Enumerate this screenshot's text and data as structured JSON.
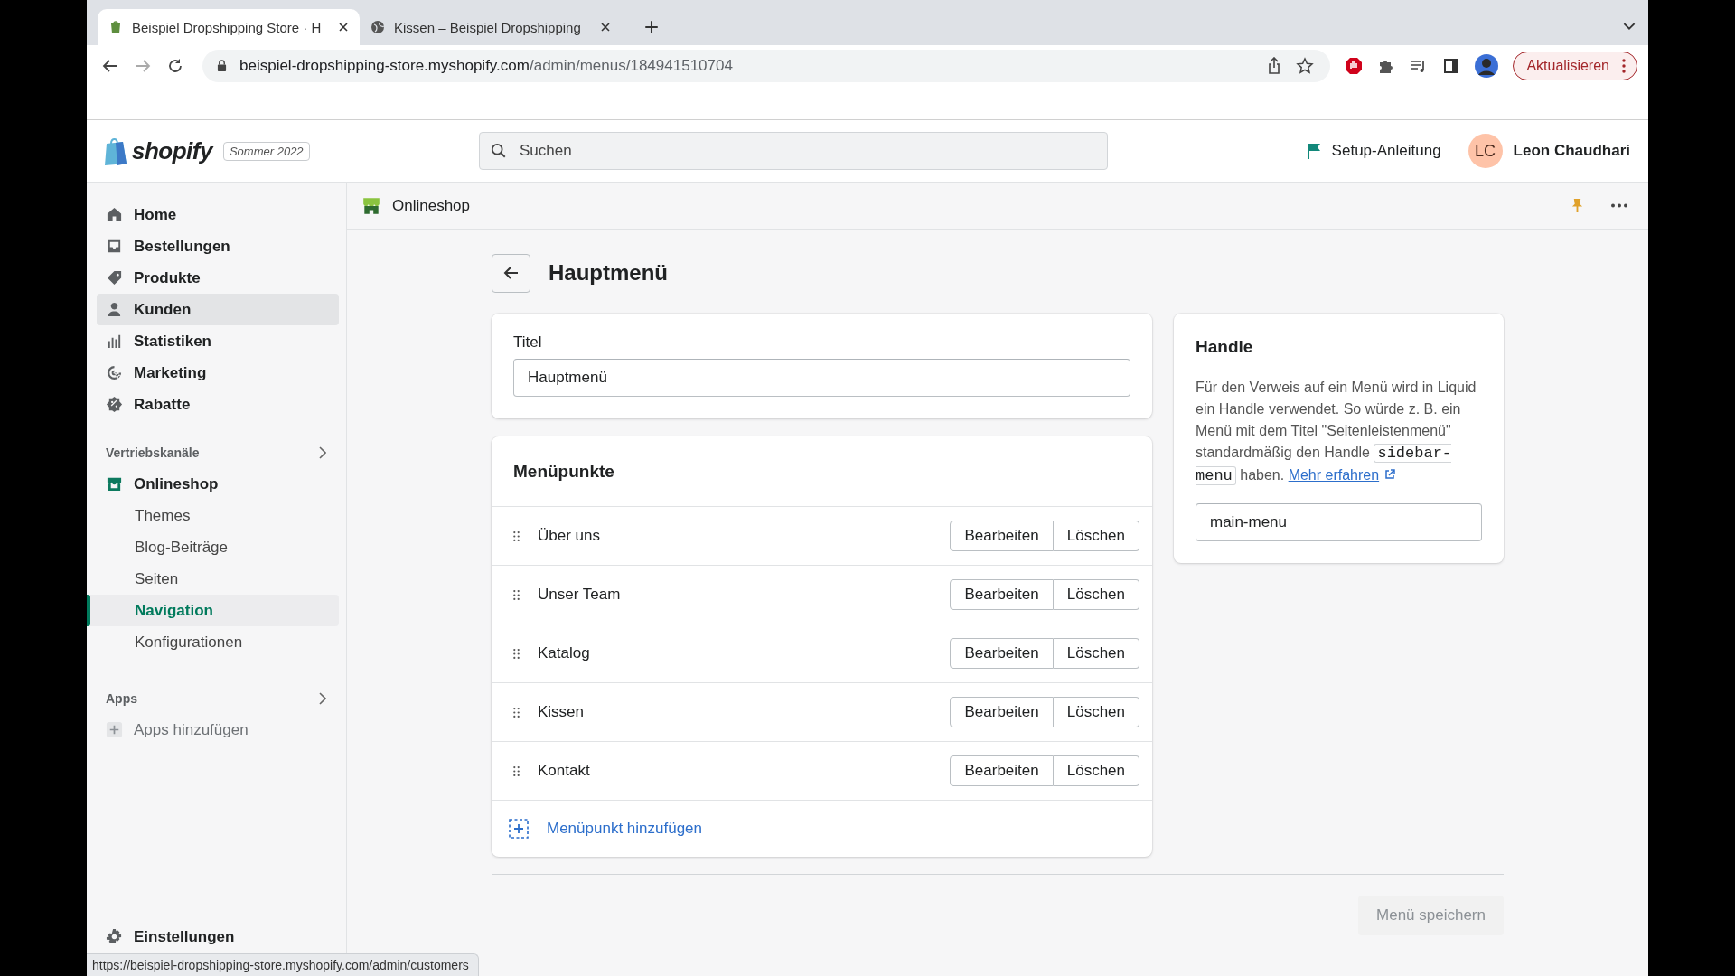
{
  "browser": {
    "tabs": [
      {
        "title": "Beispiel Dropshipping Store · H",
        "selected": true
      },
      {
        "title": "Kissen – Beispiel Dropshipping",
        "selected": false
      }
    ],
    "url": {
      "host": "beispiel-dropshipping-store.myshopify.com",
      "path": "/admin/menus/184941510704"
    },
    "update_button": "Aktualisieren"
  },
  "topbar": {
    "logo": "shopify",
    "edition": "Sommer 2022",
    "search": {
      "placeholder": "Suchen"
    },
    "setup": "Setup-Anleitung",
    "user": {
      "initials": "LC",
      "name": "Leon Chaudhari"
    }
  },
  "sidebar": {
    "items": [
      {
        "label": "Home",
        "hovered": false
      },
      {
        "label": "Bestellungen",
        "hovered": false
      },
      {
        "label": "Produkte",
        "hovered": false
      },
      {
        "label": "Kunden",
        "hovered": true
      },
      {
        "label": "Statistiken",
        "hovered": false
      },
      {
        "label": "Marketing",
        "hovered": false
      },
      {
        "label": "Rabatte",
        "hovered": false
      }
    ],
    "channels": {
      "heading": "Vertriebskanäle",
      "channel": "Onlineshop",
      "children": [
        {
          "label": "Themes",
          "selected": false
        },
        {
          "label": "Blog-Beiträge",
          "selected": false
        },
        {
          "label": "Seiten",
          "selected": false
        },
        {
          "label": "Navigation",
          "selected": true
        },
        {
          "label": "Konfigurationen",
          "selected": false
        }
      ]
    },
    "apps": {
      "heading": "Apps",
      "add": "Apps hinzufügen"
    },
    "settings": "Einstellungen"
  },
  "channel_header": "Onlineshop",
  "page": {
    "title": "Hauptmenü",
    "title_field": {
      "label": "Titel",
      "value": "Hauptmenü"
    },
    "menu": {
      "heading": "Menüpunkte",
      "items": [
        {
          "label": "Über uns",
          "edit": "Bearbeiten",
          "delete": "Löschen"
        },
        {
          "label": "Unser Team",
          "edit": "Bearbeiten",
          "delete": "Löschen"
        },
        {
          "label": "Katalog",
          "edit": "Bearbeiten",
          "delete": "Löschen"
        },
        {
          "label": "Kissen",
          "edit": "Bearbeiten",
          "delete": "Löschen"
        },
        {
          "label": "Kontakt",
          "edit": "Bearbeiten",
          "delete": "Löschen"
        }
      ],
      "add": "Menüpunkt hinzufügen"
    },
    "handle": {
      "heading": "Handle",
      "text_before": "Für den Verweis auf ein Menü wird in Liquid ein Handle verwendet. So würde z. B. ein Menü mit dem Titel \"Seitenleistenmenü\" standardmäßig den Handle",
      "code": "sidebar-menu",
      "text_after": "haben.",
      "link": "Mehr erfahren",
      "value": "main-menu"
    },
    "save_button": {
      "label": "Menü speichern",
      "disabled": true
    }
  },
  "status_url": "https://beispiel-dropshipping-store.myshopify.com/admin/customers"
}
